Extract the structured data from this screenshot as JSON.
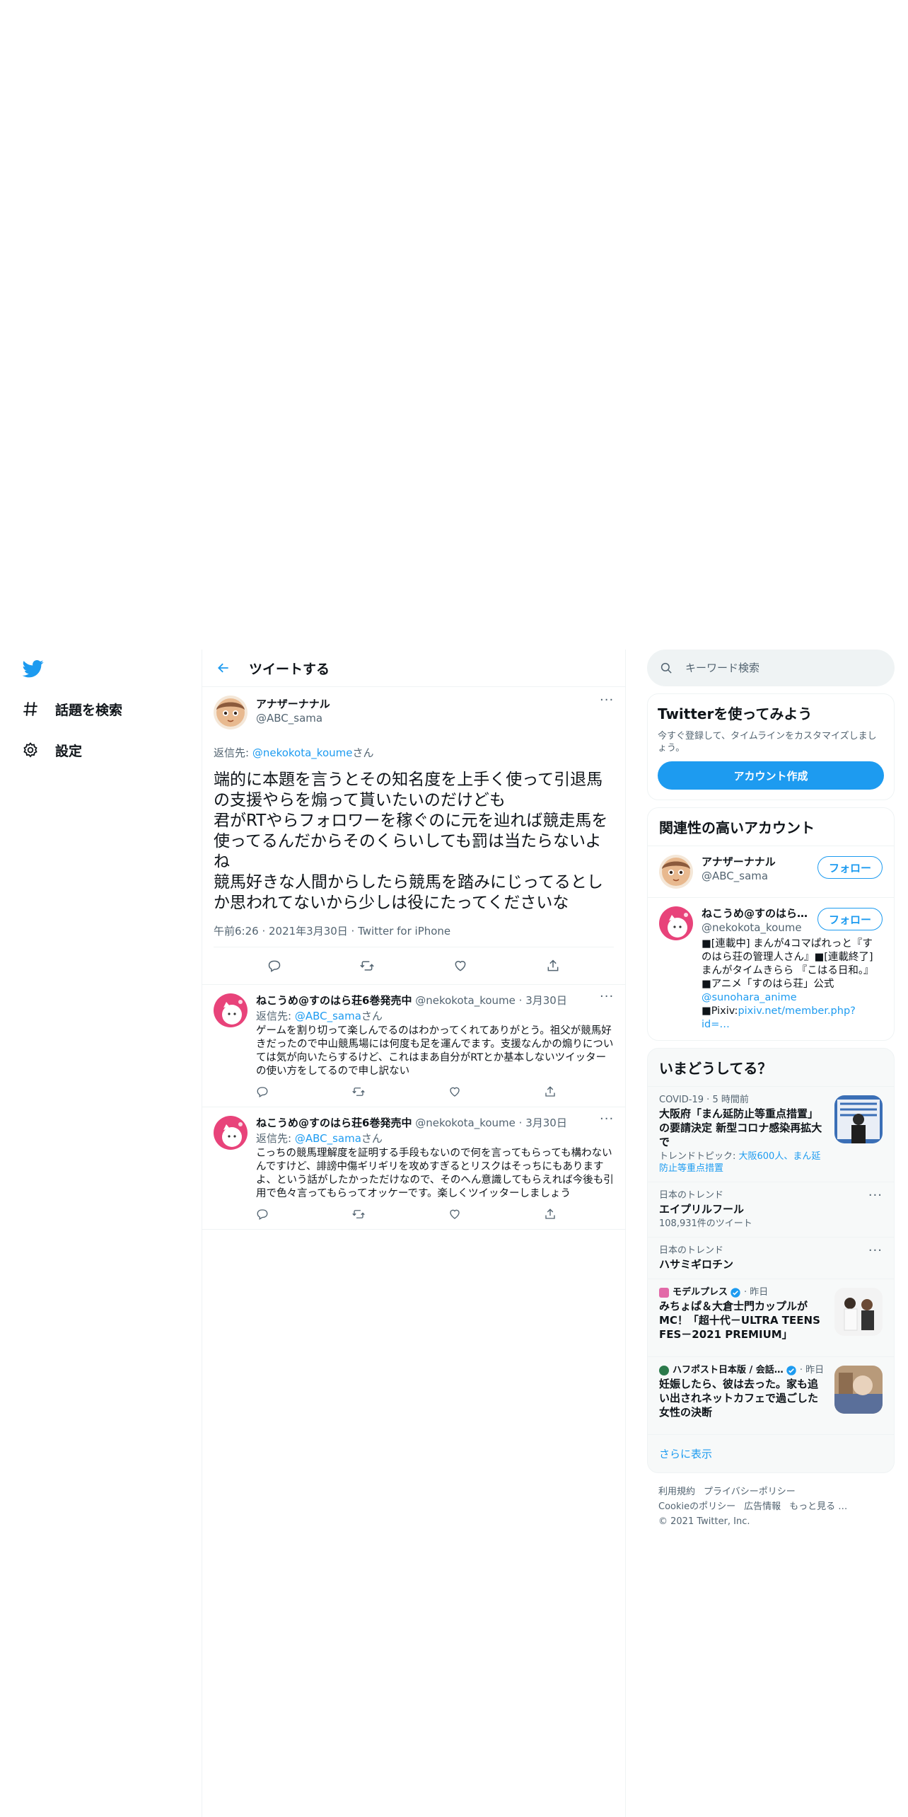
{
  "nav": {
    "items": [
      {
        "label": "話題を検索",
        "icon": "hashtag-icon"
      },
      {
        "label": "設定",
        "icon": "gear-icon"
      }
    ]
  },
  "header": {
    "title": "ツイートする"
  },
  "main_tweet": {
    "author_name": "アナザーナナル",
    "author_handle": "@ABC_sama",
    "reply_prefix": "返信先: ",
    "reply_handle": "@nekokota_koume",
    "reply_suffix": "さん",
    "text": "端的に本題を言うとその知名度を上手く使って引退馬の支援やらを煽って貰いたいのだけども\n君がRTやらフォロワーを稼ぐのに元を辿れば競走馬を使ってるんだからそのくらいしても罰は当たらないよね\n競馬好きな人間からしたら競馬を踏みにじってるとしか思われてないから少しは役にたってくださいな",
    "meta": "午前6:26 · 2021年3月30日 · Twitter for iPhone"
  },
  "replies": [
    {
      "name": "ねこうめ@すのはら荘6巻発売中",
      "handle": "@nekokota_koume",
      "date": "· 3月30日",
      "reply_prefix": "返信先: ",
      "reply_handle": "@ABC_sama",
      "reply_suffix": "さん",
      "text": "ゲームを割り切って楽しんでるのはわかってくれてありがとう。祖父が競馬好きだったので中山競馬場には何度も足を運んでます。支援なんかの煽りについては気が向いたらするけど、これはまあ自分がRTとか基本しないツイッターの使い方をしてるので申し訳ない"
    },
    {
      "name": "ねこうめ@すのはら荘6巻発売中",
      "handle": "@nekokota_koume",
      "date": "· 3月30日",
      "reply_prefix": "返信先: ",
      "reply_handle": "@ABC_sama",
      "reply_suffix": "さん",
      "text": "こっちの競馬理解度を証明する手段もないので何を言ってもらっても構わないんですけど、誹謗中傷ギリギリを攻めすぎるとリスクはそっちにもありますよ、という話がしたかっただけなので、そのへん意識してもらえれば今後も引用で色々言ってもらってオッケーです。楽しくツイッターしましょう"
    }
  ],
  "search": {
    "placeholder": "キーワード検索"
  },
  "signup": {
    "title": "Twitterを使ってみよう",
    "sub": "今すぐ登録して、タイムラインをカスタマイズしましょう。",
    "button": "アカウント作成"
  },
  "accounts": {
    "title": "関連性の高いアカウント",
    "follow_label": "フォロー",
    "items": [
      {
        "name": "アナザーナナル",
        "handle": "@ABC_sama",
        "bio": ""
      },
      {
        "name": "ねこうめ@すのはら…",
        "handle": "@nekokota_koume",
        "bio_1": "■[連載中] まんが4コマぱれっと『すのはら荘の管理人さん』■[連載終了]まんがタイムきらら 『こはる日和。』\n■アニメ「すのはら荘」公式",
        "bio_link1": "@sunohara_anime",
        "bio_2": "■Pixiv:",
        "bio_link2": "pixiv.net/member.php?id=…"
      }
    ]
  },
  "trends": {
    "title": "いまどうしてる？",
    "items": [
      {
        "meta": "COVID-19 · 5 時間前",
        "title": "大阪府「まん延防止等重点措置」の要請決定 新型コロナ感染再拡大で",
        "sub_prefix": "トレンドトピック: ",
        "sub_link": "大阪600人、まん延防止等重点措置"
      },
      {
        "meta": "日本のトレンド",
        "title": "エイプリルフール",
        "sub": "108,931件のツイート"
      },
      {
        "meta": "日本のトレンド",
        "title": "ハサミギロチン"
      },
      {
        "source": "モデルプレス",
        "time": "· 昨日",
        "title": "みちょぱ＆大倉士門カップルがMC！「超十代－ULTRA TEENS FES－2021 PREMIUM」"
      },
      {
        "source": "ハフポスト日本版 / 会話…",
        "time": "· 昨日",
        "title": "妊娠したら、彼は去った。家も追い出されネットカフェで過ごした女性の決断"
      }
    ],
    "show_more": "さらに表示"
  },
  "footer": {
    "links_1": [
      "利用規約",
      "プライバシーポリシー"
    ],
    "links_2": [
      "Cookieのポリシー",
      "広告情報",
      "もっと見る …"
    ],
    "copyright": "© 2021 Twitter, Inc."
  },
  "colors": {
    "accent": "#1d9bf0",
    "text": "#0f1419",
    "muted": "#536471",
    "border": "#eff3f4",
    "panel": "#f7f9f9"
  }
}
